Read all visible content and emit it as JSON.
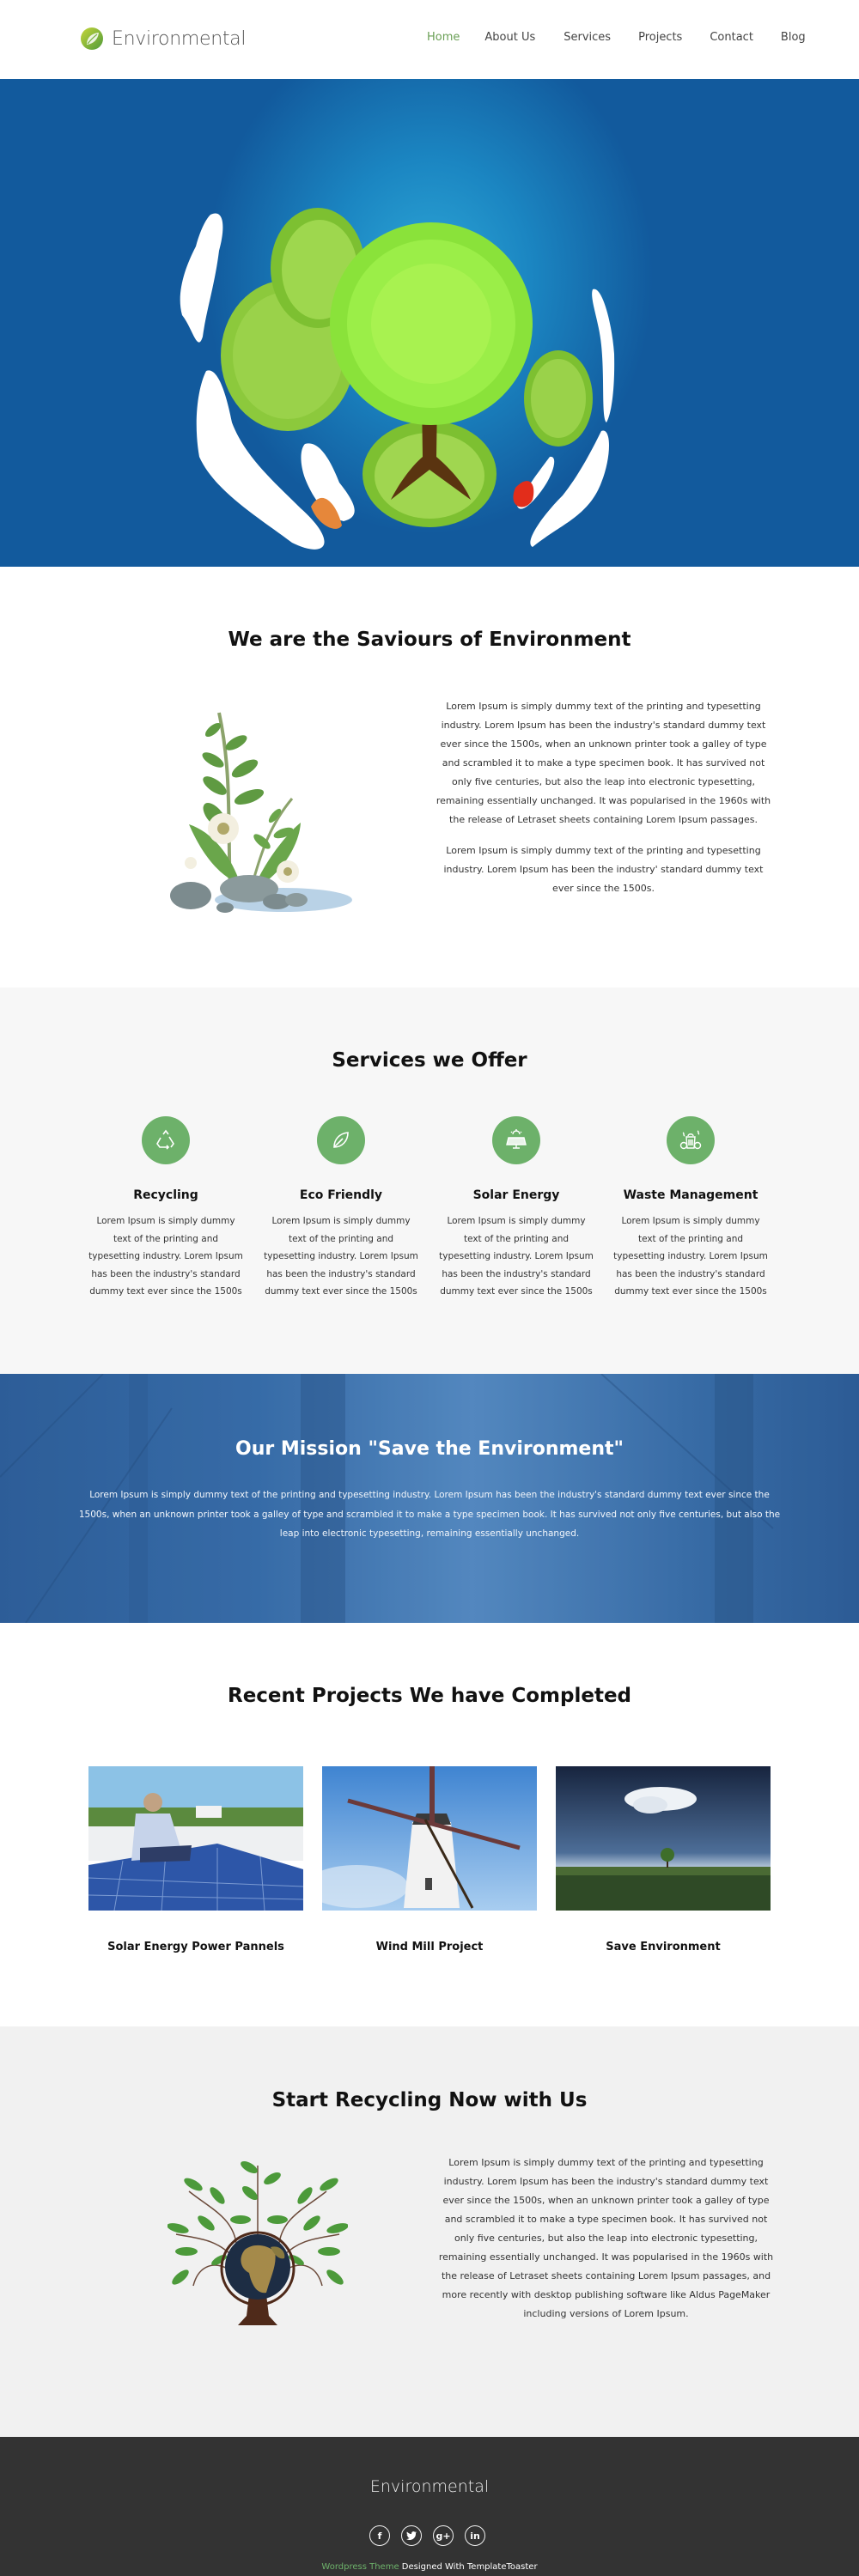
{
  "header": {
    "brand": "Environmental",
    "nav": [
      {
        "label": "Home",
        "active": true
      },
      {
        "label": "About Us",
        "active": false
      },
      {
        "label": "Services",
        "active": false
      },
      {
        "label": "Projects",
        "active": false
      },
      {
        "label": "Contact",
        "active": false
      },
      {
        "label": "Blog",
        "active": false
      }
    ]
  },
  "hero": {
    "image": "tree-planet-illustration"
  },
  "about": {
    "title": "We are the Saviours of Environment",
    "image": "plants-and-stones-illustration",
    "paragraphs": [
      "Lorem Ipsum is simply dummy text of the printing and typesetting industry. Lorem Ipsum has been the industry's standard dummy text ever since the 1500s, when an unknown printer took a galley of type and scrambled it to make a type specimen book. It has survived not only five centuries, but also the leap into electronic typesetting, remaining essentially unchanged. It was popularised in the 1960s with the release of Letraset sheets containing Lorem Ipsum passages.",
      "Lorem Ipsum is simply dummy text of the printing and typesetting industry. Lorem Ipsum has been the industry' standard dummy text ever since the 1500s."
    ]
  },
  "services": {
    "title": "Services we Offer",
    "accent": "#6db16a",
    "items": [
      {
        "icon": "recycle-icon",
        "title": "Recycling",
        "text": "Lorem Ipsum is simply dummy text of the printing and typesetting industry. Lorem Ipsum has been the industry's standard dummy text ever since the 1500s"
      },
      {
        "icon": "leaf-icon",
        "title": "Eco Friendly",
        "text": "Lorem Ipsum is simply dummy text of the printing and typesetting industry. Lorem Ipsum has been the industry's standard dummy text ever since the 1500s"
      },
      {
        "icon": "solar-panel-icon",
        "title": "Solar Energy",
        "text": "Lorem Ipsum is simply dummy text of the printing and typesetting industry. Lorem Ipsum has been the industry's standard dummy text ever since the 1500s"
      },
      {
        "icon": "waste-bin-icon",
        "title": "Waste Management",
        "text": "Lorem Ipsum is simply dummy text of the printing and typesetting industry. Lorem Ipsum has been the industry's standard dummy text ever since the 1500s"
      }
    ]
  },
  "mission": {
    "title": "Our Mission \"Save the Environment\"",
    "text": "Lorem Ipsum is simply dummy text of the printing and typesetting industry. Lorem Ipsum has been the industry's standard dummy text ever since the 1500s, when an unknown printer took a galley of type and scrambled it to make a type specimen book. It has survived not only five centuries, but also the leap into electronic typesetting, remaining essentially unchanged."
  },
  "projects": {
    "title": "Recent Projects We have Completed",
    "items": [
      {
        "title": "Solar Energy Power Pannels",
        "image": "worker-installing-solar-panels-photo"
      },
      {
        "title": "Wind Mill Project",
        "image": "windmill-photo"
      },
      {
        "title": "Save Environment",
        "image": "lone-tree-field-photo"
      }
    ]
  },
  "recycling": {
    "title": "Start Recycling Now with Us",
    "image": "earth-tree-illustration",
    "text": "Lorem Ipsum is simply dummy text of the printing and typesetting industry. Lorem Ipsum has been the industry's standard dummy text ever since the 1500s, when an unknown printer took a galley of type and scrambled it to make a type specimen book. It has survived not only five centuries, but also the leap into electronic typesetting, remaining essentially unchanged. It was popularised in the 1960s with the release of Letraset sheets containing Lorem Ipsum passages, and more recently with desktop publishing software like Aldus PageMaker including versions of Lorem Ipsum."
  },
  "footer": {
    "brand": "Environmental",
    "social": [
      {
        "icon": "facebook-icon",
        "glyph": "f"
      },
      {
        "icon": "twitter-icon",
        "glyph": "t"
      },
      {
        "icon": "google-plus-icon",
        "glyph": "g+"
      },
      {
        "icon": "linkedin-icon",
        "glyph": "in"
      }
    ],
    "credit_link": "Wordpress Theme",
    "credit_text": " Designed With TemplateToaster"
  }
}
